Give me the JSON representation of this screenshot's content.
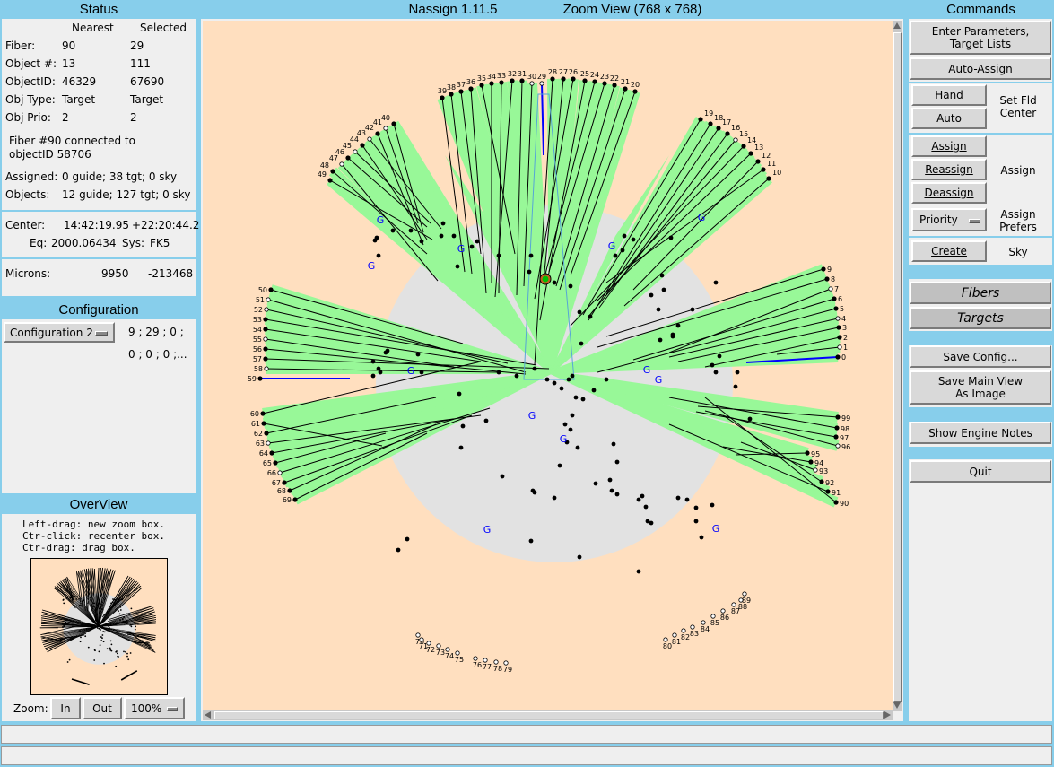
{
  "status": {
    "header": "Status",
    "col_nearest": "Nearest",
    "col_selected": "Selected",
    "rows": [
      {
        "label": "Fiber:",
        "nearest": "90",
        "selected": "29"
      },
      {
        "label": "Object #:",
        "nearest": "13",
        "selected": "111"
      },
      {
        "label": "ObjectID:",
        "nearest": "46329",
        "selected": "67690"
      },
      {
        "label": "Obj Type:",
        "nearest": "Target",
        "selected": "Target"
      },
      {
        "label": "Obj Prio:",
        "nearest": "2",
        "selected": "2"
      }
    ],
    "message_line1": "Fiber #90 connected to",
    "message_line2": "objectID 58706",
    "assigned_label": "Assigned:",
    "assigned_value": "0 guide; 38 tgt; 0 sky",
    "objects_label": "Objects:",
    "objects_value": "12 guide; 127 tgt; 0 sky",
    "center_label": "Center:",
    "center_ra": "14:42:19.95",
    "center_dec": "+22:20:44.2",
    "eq_label": "Eq:",
    "eq_value": "2000.06434",
    "sys_label": "Sys:",
    "sys_value": "FK5",
    "microns_label": "Microns:",
    "microns_x": "9950",
    "microns_y": "-213468"
  },
  "configuration": {
    "header": "Configuration",
    "selected": "Configuration 2",
    "line1": "9 ; 29 ; 0 ;",
    "line2": "0 ; 0 ; 0 ;..."
  },
  "overview": {
    "header": "OverView",
    "help1": "Left-drag: new zoom box.",
    "help2": "Ctr-click: recenter box.",
    "help3": "Ctr-drag: drag box.",
    "zoom_label": "Zoom:",
    "zoom_in": "In",
    "zoom_out": "Out",
    "zoom_value": "100%"
  },
  "center": {
    "app_title": "Nassign 1.11.5",
    "view_title": "Zoom View (768 x 768)"
  },
  "commands": {
    "header": "Commands",
    "enter_params_1": "Enter Parameters,",
    "enter_params_2": "Target Lists",
    "auto_assign": "Auto-Assign",
    "hand": "Hand",
    "auto": "Auto",
    "set_fld_center_1": "Set Fld",
    "set_fld_center_2": "Center",
    "assign": "Assign",
    "reassign": "Reassign",
    "deassign": "Deassign",
    "assign_group": "Assign",
    "priority": "Priority",
    "assign_prefers_1": "Assign",
    "assign_prefers_2": "Prefers",
    "create": "Create",
    "sky": "Sky",
    "fibers": "Fibers",
    "targets": "Targets",
    "save_config": "Save Config...",
    "save_main_view_1": "Save Main View",
    "save_main_view_2": "As Image",
    "show_engine_notes": "Show Engine Notes",
    "quit": "Quit"
  },
  "colors": {
    "background": "#87ceeb",
    "panel": "#efefef",
    "plot_bg": "#ffdfbf",
    "field_disk": "#e2e2e2",
    "fiber_wedge": "#98f898",
    "guide_label": "#0000ff"
  },
  "plot": {
    "guide_marker": "G",
    "fiber_labels": [
      "0",
      "1",
      "2",
      "3",
      "4",
      "5",
      "6",
      "7",
      "8",
      "9",
      "10",
      "11",
      "12",
      "13",
      "14",
      "15",
      "16",
      "17",
      "18",
      "19",
      "20",
      "21",
      "22",
      "23",
      "24",
      "25",
      "26",
      "27",
      "28",
      "29",
      "30",
      "31",
      "32",
      "33",
      "34",
      "35",
      "36",
      "37",
      "38",
      "39",
      "40",
      "41",
      "42",
      "43",
      "44",
      "45",
      "46",
      "47",
      "48",
      "49",
      "50",
      "51",
      "52",
      "53",
      "54",
      "55",
      "56",
      "57",
      "58",
      "59",
      "60",
      "61",
      "62",
      "63",
      "64",
      "65",
      "66",
      "67",
      "68",
      "69",
      "70",
      "71",
      "72",
      "73",
      "74",
      "75",
      "76",
      "77",
      "78",
      "79",
      "80",
      "81",
      "82",
      "83",
      "84",
      "85",
      "86",
      "87",
      "88",
      "89",
      "90",
      "91",
      "92",
      "93",
      "94",
      "95",
      "96",
      "97",
      "98",
      "99"
    ]
  }
}
